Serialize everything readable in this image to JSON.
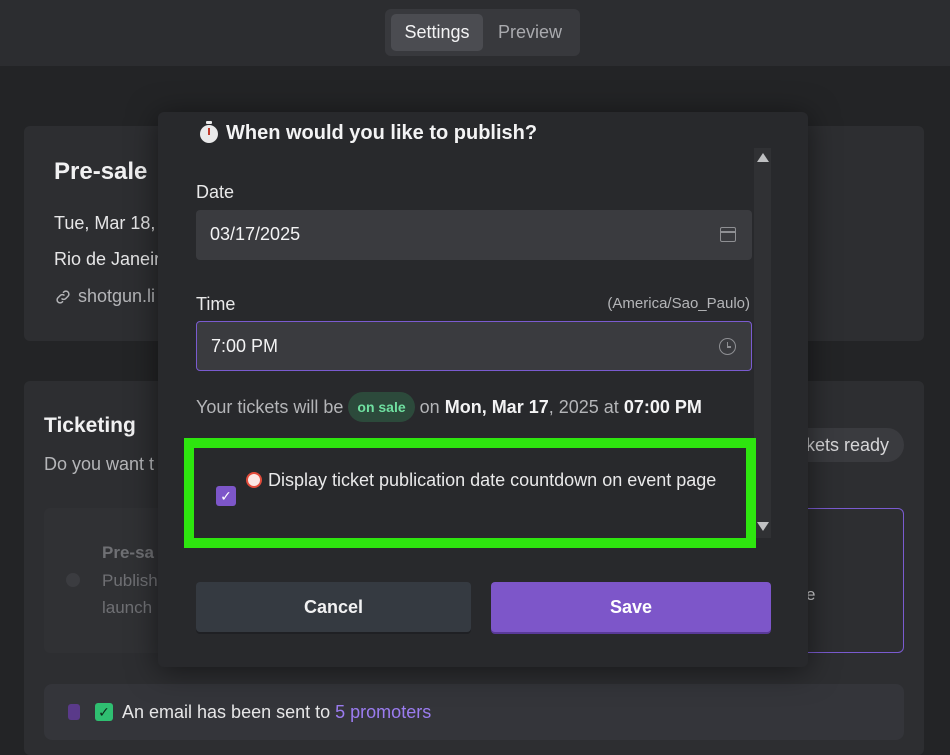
{
  "topbar": {
    "tabs": [
      {
        "label": "Settings"
      },
      {
        "label": "Preview"
      }
    ]
  },
  "background": {
    "event_title": "Pre-sale",
    "event_date": "Tue, Mar 18,",
    "event_location": "Rio de Janeir",
    "event_link": "shotgun.li",
    "ticketing_title": "Ticketing",
    "ticketing_question": "Do you want t",
    "tickets_ready_label": "kets ready",
    "option_left_title": "Pre-sa",
    "option_left_line2": "Publish",
    "option_left_line3": "launch",
    "option_right_text": "e",
    "email_notice": "An email has been sent to",
    "email_link": "5 promoters"
  },
  "modal": {
    "title": "When would you like to publish?",
    "date_label": "Date",
    "date_value": "03/17/2025",
    "time_label": "Time",
    "timezone": "(America/Sao_Paulo)",
    "time_value": "7:00 PM",
    "sale_prefix": "Your tickets will be",
    "sale_badge": "on sale",
    "sale_on": "on",
    "sale_date": "Mon, Mar 17",
    "sale_year": ", 2025 at",
    "sale_time": "07:00 PM",
    "countdown_label": "Display ticket publication date countdown on event page",
    "countdown_checked": true,
    "cancel_label": "Cancel",
    "save_label": "Save"
  },
  "colors": {
    "accent": "#7d56c9",
    "highlight": "#2ee50f",
    "success": "#2fbf71"
  }
}
